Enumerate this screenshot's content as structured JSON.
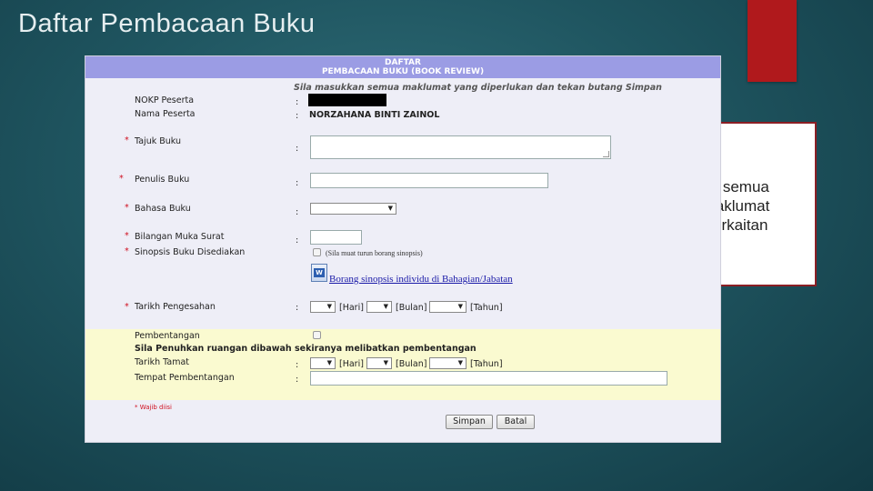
{
  "slide": {
    "title": "Daftar Pembacaan Buku",
    "note": "Isi semua maklumat berkaitan"
  },
  "form": {
    "header_line1": "DAFTAR",
    "header_line2": "PEMBACAAN BUKU (BOOK REVIEW)",
    "instruction": "Sila masukkan semua maklumat yang diperlukan dan tekan butang Simpan",
    "colon": ":",
    "required_mark": "*",
    "fields": {
      "nokp_label": "NOKP Peserta",
      "nama_label": "Nama Peserta",
      "nama_value": "NORZAHANA BINTI ZAINOL",
      "tajuk_label": "Tajuk Buku",
      "penulis_label": "Penulis Buku",
      "bahasa_label": "Bahasa Buku",
      "bilangan_label": "Bilangan Muka Surat",
      "sinopsis_label": "Sinopsis Buku Disediakan",
      "sinopsis_hint": "(Sila muat turun borang sinopsis)",
      "sinopsis_link": "Borang sinopsis individu di Bahagian/Jabatan",
      "tarikh_pengesahan_label": "Tarikh Pengesahan",
      "hari": "[Hari]",
      "bulan": "[Bulan]",
      "tahun": "[Tahun]"
    },
    "pembentangan": {
      "label": "Pembentangan",
      "notice": "Sila Penuhkan ruangan dibawah sekiranya melibatkan pembentangan",
      "tarikh_tamat_label": "Tarikh Tamat",
      "tempat_label": "Tempat Pembentangan"
    },
    "wajib": "* Wajib diisi",
    "buttons": {
      "simpan": "Simpan",
      "batal": "Batal"
    },
    "icons": {
      "word_doc": "W",
      "dropdown_arrow": "▼"
    }
  }
}
